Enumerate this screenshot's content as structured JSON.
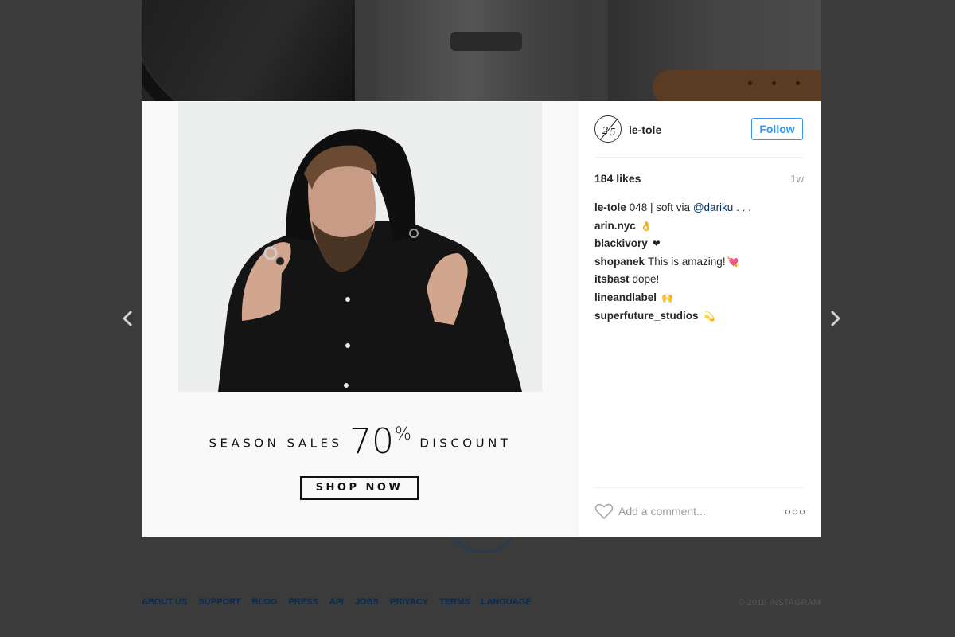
{
  "post": {
    "username": "le-tole",
    "avatar_text": "2/5",
    "follow_label": "Follow",
    "likes": "184 likes",
    "time_ago": "1w",
    "caption": {
      "user": "le-tole",
      "text": "048 | soft via",
      "mention": "@dariku",
      "ellipsis": ". . ."
    },
    "comments": [
      {
        "user": "arin.nyc",
        "text": "",
        "emoji": "👌"
      },
      {
        "user": "blackivory",
        "text": "",
        "emoji": "❤"
      },
      {
        "user": "shopanek",
        "text": "This is amazing!",
        "emoji": "💘"
      },
      {
        "user": "itsbast",
        "text": "dope!",
        "emoji": ""
      },
      {
        "user": "lineandlabel",
        "text": "",
        "emoji": "🙌"
      },
      {
        "user": "superfuture_studios",
        "text": "",
        "emoji": "💫"
      }
    ],
    "comment_placeholder": "Add a comment..."
  },
  "promo": {
    "word_left": "SEASON SALES",
    "big_number": "70",
    "percent": "%",
    "word_right": "DISCOUNT",
    "button_label": "SHOP NOW"
  },
  "nav": {
    "prev_icon": "chevron-left-icon",
    "next_icon": "chevron-right-icon"
  },
  "footer": {
    "links": [
      "ABOUT US",
      "SUPPORT",
      "BLOG",
      "PRESS",
      "API",
      "JOBS",
      "PRIVACY",
      "TERMS",
      "LANGUAGE"
    ],
    "copyright": "© 2016 INSTAGRAM"
  },
  "colors": {
    "accent": "#3897f0",
    "overlay": "#3b3b3b",
    "link": "#0a2a52"
  }
}
